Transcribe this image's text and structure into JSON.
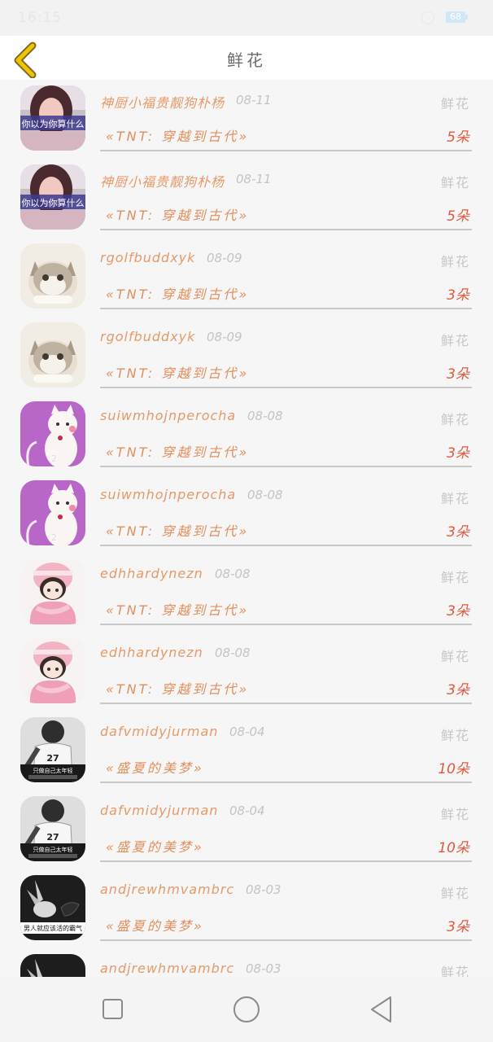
{
  "status_bar": {
    "time": "16:15",
    "battery": "68"
  },
  "header": {
    "title": "鲜花"
  },
  "records": [
    {
      "user": "神厨小福贵靓狗朴杨",
      "date": "08-11",
      "gift": "鲜花",
      "work": "«TNT: 穿越到古代»",
      "count": "5朵",
      "avatar": "girl-photo",
      "avatar_caption": "你以为你算什么"
    },
    {
      "user": "神厨小福贵靓狗朴杨",
      "date": "08-11",
      "gift": "鲜花",
      "work": "«TNT: 穿越到古代»",
      "count": "5朵",
      "avatar": "girl-photo",
      "avatar_caption": "你以为你算什么"
    },
    {
      "user": "rgolfbuddxyk",
      "date": "08-09",
      "gift": "鲜花",
      "work": "«TNT: 穿越到古代»",
      "count": "3朵",
      "avatar": "cat-photo",
      "avatar_caption": ""
    },
    {
      "user": "rgolfbuddxyk",
      "date": "08-09",
      "gift": "鲜花",
      "work": "«TNT: 穿越到古代»",
      "count": "3朵",
      "avatar": "cat-photo",
      "avatar_caption": ""
    },
    {
      "user": "suiwmhojnperocha",
      "date": "08-08",
      "gift": "鲜花",
      "work": "«TNT: 穿越到古代»",
      "count": "3朵",
      "avatar": "cartoon-cat",
      "avatar_caption": ""
    },
    {
      "user": "suiwmhojnperocha",
      "date": "08-08",
      "gift": "鲜花",
      "work": "«TNT: 穿越到古代»",
      "count": "3朵",
      "avatar": "cartoon-cat",
      "avatar_caption": ""
    },
    {
      "user": "edhhardynezn",
      "date": "08-08",
      "gift": "鲜花",
      "work": "«TNT: 穿越到古代»",
      "count": "3朵",
      "avatar": "cartoon-girl",
      "avatar_caption": ""
    },
    {
      "user": "edhhardynezn",
      "date": "08-08",
      "gift": "鲜花",
      "work": "«TNT: 穿越到古代»",
      "count": "3朵",
      "avatar": "cartoon-girl",
      "avatar_caption": ""
    },
    {
      "user": "dafvmidyjurman",
      "date": "08-04",
      "gift": "鲜花",
      "work": "«盛夏的美梦»",
      "count": "10朵",
      "avatar": "bw-boy",
      "avatar_caption": "只做自己太年轻"
    },
    {
      "user": "dafvmidyjurman",
      "date": "08-04",
      "gift": "鲜花",
      "work": "«盛夏的美梦»",
      "count": "10朵",
      "avatar": "bw-boy",
      "avatar_caption": "只做自己太年轻"
    },
    {
      "user": "andjrewhmvambrc",
      "date": "08-03",
      "gift": "鲜花",
      "work": "«盛夏的美梦»",
      "count": "3朵",
      "avatar": "bw-hands",
      "avatar_caption": "男人就应该活的霸气"
    },
    {
      "user": "andjrewhmvambrc",
      "date": "08-03",
      "gift": "鲜花",
      "work": "",
      "count": "",
      "avatar": "bw-hands",
      "avatar_caption": ""
    }
  ],
  "icons": {
    "back": "chevron-left-icon",
    "recent": "square-icon",
    "home": "circle-icon",
    "back_nav": "triangle-back-icon"
  },
  "colors": {
    "accent": "#e59a68",
    "count": "#e2583c",
    "back": "#f2c400"
  }
}
